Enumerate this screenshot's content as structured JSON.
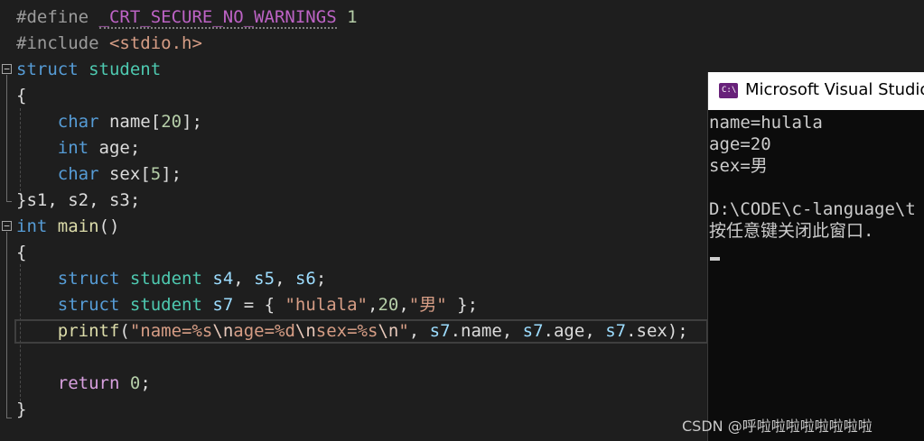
{
  "editor": {
    "lines": {
      "l1": {
        "kw": "#define",
        "macro": "_CRT_SECURE_NO_WARNINGS",
        "num": "1"
      },
      "l2": {
        "kw": "#include",
        "header": "<stdio.h>"
      },
      "l3": {
        "kw": "struct",
        "type": "student"
      },
      "l4": {
        "brace": "{"
      },
      "l5": {
        "kw": "char",
        "name": "name",
        "open": "[",
        "num": "20",
        "close": "];"
      },
      "l6": {
        "kw": "int",
        "name": "age;"
      },
      "l7": {
        "kw": "char",
        "name": "sex",
        "open": "[",
        "num": "5",
        "close": "];"
      },
      "l8": {
        "text": "}s1, s2, s3;"
      },
      "l9": {
        "kw": "int",
        "fn": "main",
        "paren": "()"
      },
      "l10": {
        "brace": "{"
      },
      "l11": {
        "kw": "struct",
        "type": "student",
        "v1": "s4",
        "sep1": ", ",
        "v2": "s5",
        "sep2": ", ",
        "v3": "s6",
        "end": ";"
      },
      "l12": {
        "kw": "struct",
        "type": "student",
        "var": "s7",
        "eq": " = { ",
        "str1": "\"hulala\"",
        "comma1": ",",
        "num": "20",
        "comma2": ",",
        "str2": "\"男\"",
        "end": " };"
      },
      "l13": {
        "fn": "printf",
        "open": "(",
        "s1": "\"name=%s",
        "e1": "\\n",
        "s2": "age=%d",
        "e2": "\\n",
        "s3": "sex=%s",
        "e3": "\\n",
        "s4": "\"",
        "sep1": ", ",
        "a1v": "s7",
        "a1m": ".name",
        "sep2": ", ",
        "a2v": "s7",
        "a2m": ".age",
        "sep3": ", ",
        "a3v": "s7",
        "a3m": ".sex",
        "close": ");"
      },
      "l15": {
        "kw": "return",
        "num": "0",
        "end": ";"
      },
      "l16": {
        "brace": "}"
      }
    },
    "fold_minus": "−"
  },
  "console": {
    "title": "Microsoft Visual Studio",
    "icon_glyph": "C:\\",
    "icon_name": "console-app-icon",
    "output": [
      "name=hulala",
      "age=20",
      "sex=男",
      "",
      "D:\\CODE\\c-language\\t",
      "按任意键关闭此窗口."
    ]
  },
  "watermark": "CSDN @呼啦啦啦啦啦啦啦啦",
  "colors": {
    "editor_bg": "#1e1e1e",
    "keyword": "#569cd6",
    "type": "#4ec9b0",
    "string": "#d69d85",
    "number": "#b5cea8",
    "console_bg": "#0c0c0c",
    "icon_bg": "#68217a"
  }
}
